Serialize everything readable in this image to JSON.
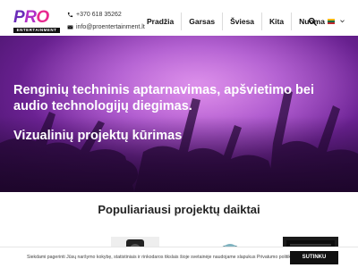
{
  "header": {
    "logo_text": {
      "p": "P",
      "r": "R",
      "o": "O",
      "sub": "ENTERTAINMENT"
    },
    "phone": "+370 618 35262",
    "email": "info@proentertainment.lt",
    "phone_icon": "phone-icon",
    "email_icon": "envelope-icon"
  },
  "nav": {
    "items": [
      {
        "label": "Pradžia"
      },
      {
        "label": "Garsas"
      },
      {
        "label": "Šviesa"
      },
      {
        "label": "Kita"
      },
      {
        "label": "Nuoma"
      }
    ],
    "search_icon": "search-icon",
    "language_flag": "lithuanian-flag-icon"
  },
  "hero": {
    "line1": "Renginių techninis aptarnavimas, apšvietimo bei audio technologijų diegimas.",
    "line2": "Vizualinių projektų kūrimas"
  },
  "products": {
    "title": "Populiariausi projektų daiktai"
  },
  "cookie": {
    "text": "Siekdami pagerinti Jūsų naršymo kokybę, statistiniais ir rinkodaros tikslais šioje svetainėje naudojame slapukus Privatumo politika",
    "button": "SUTINKU"
  },
  "colors": {
    "brand_purple": "#6a2bb8",
    "brand_pink": "#e8288f",
    "hero_purple": "#9b3fc0",
    "button_dark": "#111111"
  }
}
